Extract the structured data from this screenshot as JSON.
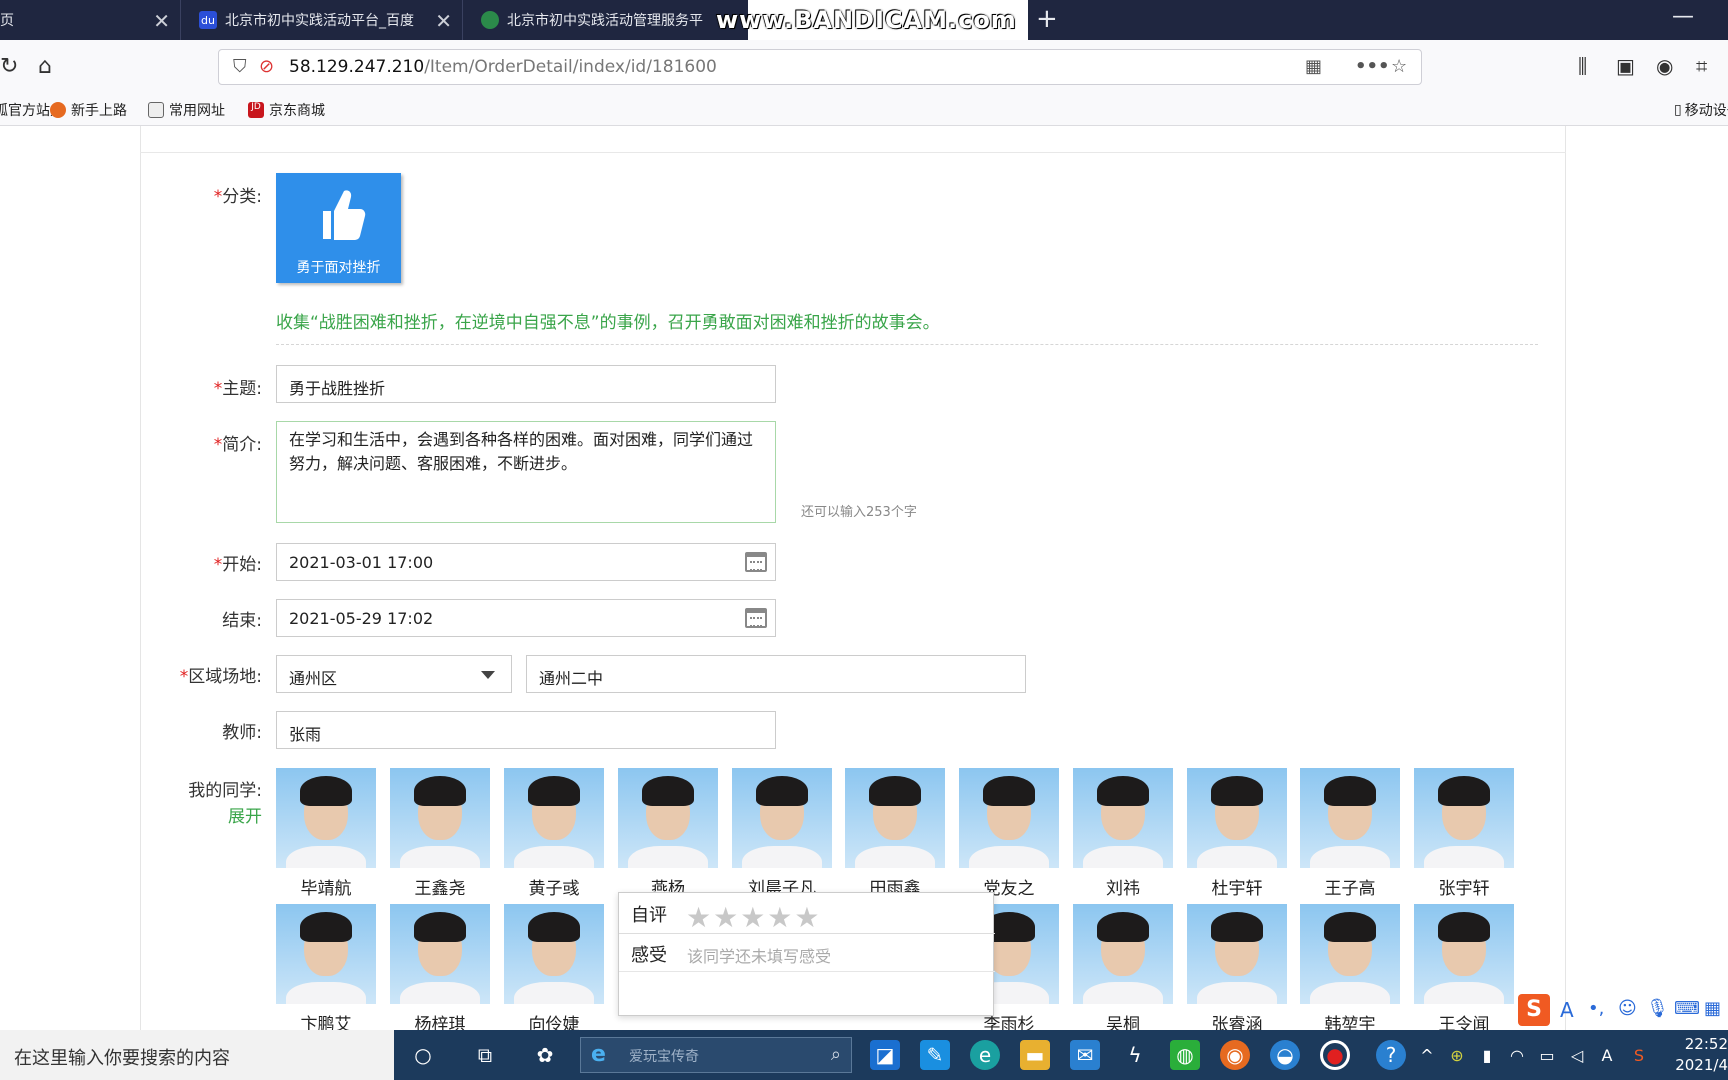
{
  "browser": {
    "tabs": [
      {
        "title": "页",
        "active": false
      },
      {
        "title": "北京市初中实践活动平台_百度",
        "active": false
      },
      {
        "title": "北京市初中实践活动管理服务平",
        "active": false
      },
      {
        "title": "",
        "active": true
      }
    ],
    "watermark": "www.BANDICAM.com",
    "url_host": "58.129.247.210",
    "url_path": "/Item/OrderDetail/index/id/181600",
    "bookmarks": [
      "火狐官方站点",
      "新手上路",
      "常用网址",
      "京东商城"
    ],
    "bookmarks_right": "移动设备"
  },
  "form": {
    "category_label": "分类:",
    "category_tile_text": "勇于面对挫折",
    "category_desc": "收集“战胜困难和挫折，在逆境中自强不息”的事例，召开勇敢面对困难和挫折的故事会。",
    "topic_label": "主题:",
    "topic_value": "勇于战胜挫折",
    "intro_label": "简介:",
    "intro_value": "在学习和生活中，会遇到各种各样的困难。面对困难，同学们通过努力，解决问题、客服困难，不断进步。",
    "remaining": "还可以输入253个字",
    "start_label": "开始:",
    "start_value": "2021-03-01 17:00",
    "end_label": "结束:",
    "end_value": "2021-05-29 17:02",
    "venue_label": "区域场地:",
    "district_value": "通州区",
    "venue_value": "通州二中",
    "teacher_label": "教师:",
    "teacher_value": "张雨",
    "classmates_label": "我的同学:",
    "expand_label": "展开",
    "required_mark": "*"
  },
  "students_row1": [
    "毕靖航",
    "王鑫尧",
    "黄子彧",
    "燕杨",
    "刘晨子凡",
    "田雨鑫",
    "党友之",
    "刘祎",
    "杜宇轩",
    "王子高",
    "张宇轩"
  ],
  "students_row2": [
    "卞鹏艾",
    "杨梓琪",
    "向伶婕",
    "李雨杉",
    "吴桐",
    "张睿涵",
    "韩堃宇",
    "王令闻"
  ],
  "popup": {
    "self_eval_label": "自评",
    "feeling_label": "感受",
    "feeling_placeholder": "该同学还未填写感受",
    "stars": "★★★★★"
  },
  "taskbar": {
    "search_placeholder": "在这里输入你要搜索的内容",
    "ie_text": "爱玩宝传奇",
    "clock_time": "22:52",
    "clock_date": "2021/4"
  }
}
